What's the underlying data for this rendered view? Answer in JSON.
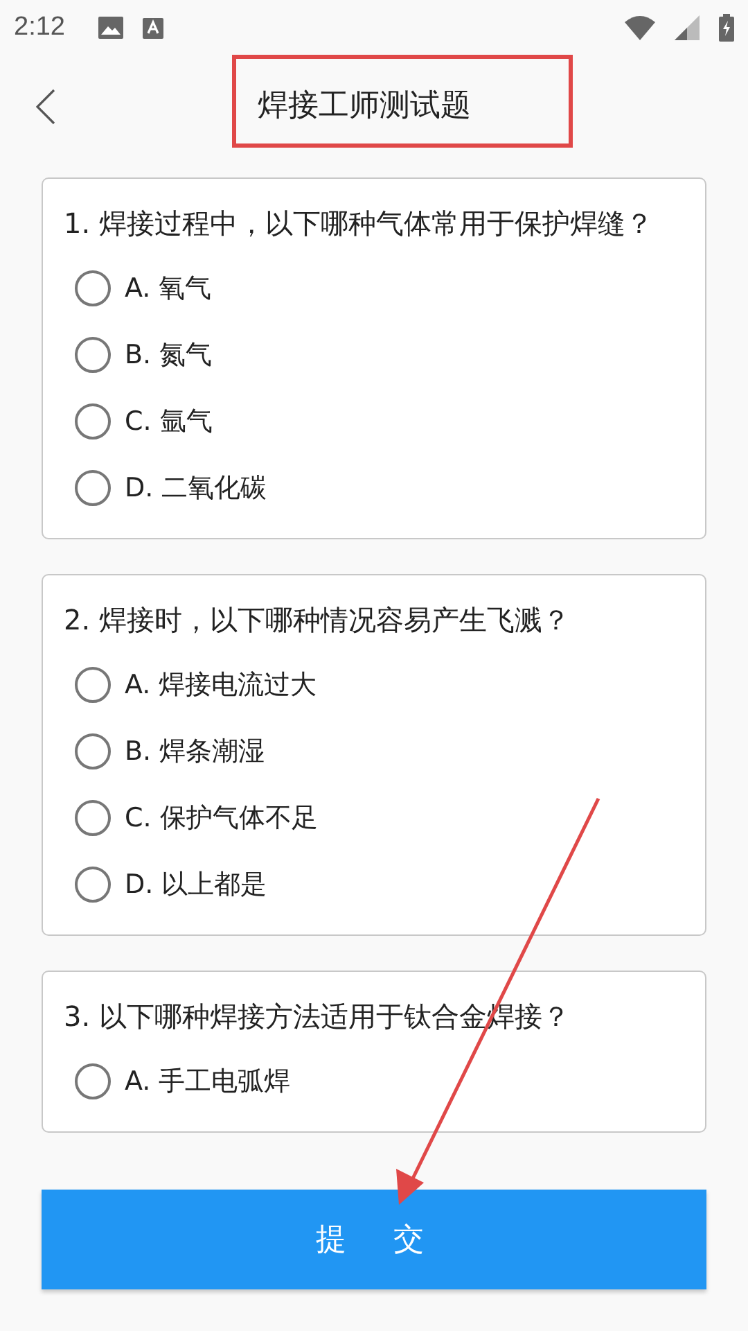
{
  "status_bar": {
    "time": "2:12"
  },
  "header": {
    "title": "焊接工师测试题"
  },
  "questions": [
    {
      "text": "1. 焊接过程中，以下哪种气体常用于保护焊缝？",
      "options": [
        {
          "label": "A. 氧气",
          "selected": false
        },
        {
          "label": "B. 氮气",
          "selected": false
        },
        {
          "label": "C. 氩气",
          "selected": false
        },
        {
          "label": "D. 二氧化碳",
          "selected": false
        }
      ]
    },
    {
      "text": "2. 焊接时，以下哪种情况容易产生飞溅？",
      "options": [
        {
          "label": "A. 焊接电流过大",
          "selected": false
        },
        {
          "label": "B. 焊条潮湿",
          "selected": false
        },
        {
          "label": "C. 保护气体不足",
          "selected": false
        },
        {
          "label": "D. 以上都是",
          "selected": false
        }
      ]
    },
    {
      "text": "3. 以下哪种焊接方法适用于钛合金焊接？",
      "options": [
        {
          "label": "A. 手工电弧焊",
          "selected": false
        }
      ]
    }
  ],
  "submit_button": "提交"
}
